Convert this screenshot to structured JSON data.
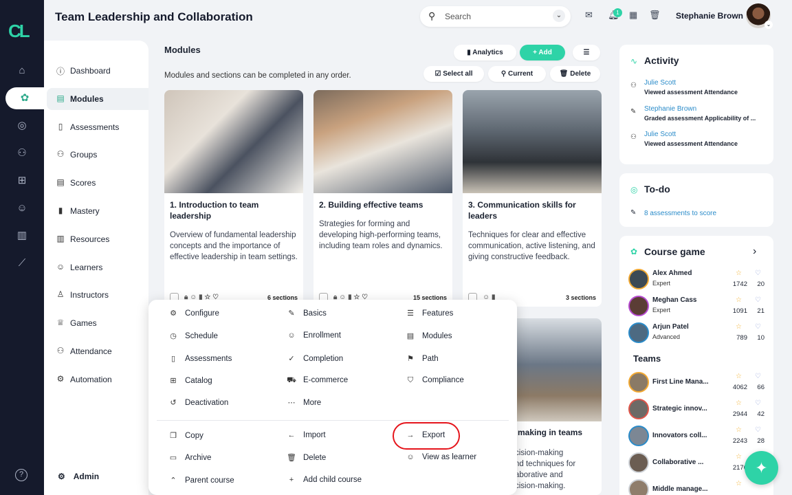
{
  "app": {
    "logo_text": "CL",
    "accent": "#2ed3a7",
    "sidebar_bg": "#151a2c",
    "highlight_color": "#e5141b"
  },
  "header": {
    "title": "Team Leadership and Collaboration",
    "search_placeholder": "Search",
    "notification_count": "1",
    "user_name": "Stephanie Brown"
  },
  "nav": [
    {
      "label": "Dashboard",
      "icon": "info-icon"
    },
    {
      "label": "Modules",
      "icon": "modules-icon",
      "active": true
    },
    {
      "label": "Assessments",
      "icon": "assessment-icon"
    },
    {
      "label": "Groups",
      "icon": "groups-icon"
    },
    {
      "label": "Scores",
      "icon": "scores-icon"
    },
    {
      "label": "Mastery",
      "icon": "mastery-icon"
    },
    {
      "label": "Resources",
      "icon": "resources-icon"
    },
    {
      "label": "Learners",
      "icon": "learners-icon"
    },
    {
      "label": "Instructors",
      "icon": "instructors-icon"
    },
    {
      "label": "Games",
      "icon": "trophy-icon"
    },
    {
      "label": "Attendance",
      "icon": "attendance-icon"
    },
    {
      "label": "Automation",
      "icon": "automation-icon"
    }
  ],
  "admin_label": "Admin",
  "modules": {
    "title": "Modules",
    "subtitle": "Modules and sections can be completed in any order.",
    "toolbar": {
      "analytics": "Analytics",
      "add": "+ Add",
      "select_all": "Select all",
      "current": "Current",
      "delete": "Delete"
    },
    "cards": [
      {
        "title": "1. Introduction to team leadership",
        "desc": "Overview of fundamental leadership concepts and the importance of effective leadership in team settings.",
        "sections": "6 sections"
      },
      {
        "title": "2. Building effective teams",
        "desc": "Strategies for forming and developing high-performing teams, including team roles and dynamics.",
        "sections": "15 sections"
      },
      {
        "title": "3. Communication skills for leaders",
        "desc": "Techniques for clear and effective communication, active listening, and giving constructive feedback.",
        "sections": "3 sections"
      }
    ],
    "card4": {
      "title": "making in teams",
      "desc_lines": [
        "cision-making",
        "nd techniques for",
        "aborative and",
        "cision-making."
      ]
    }
  },
  "menu": {
    "col1": [
      "Configure",
      "Schedule",
      "Assessments",
      "Catalog",
      "Deactivation"
    ],
    "col2": [
      "Basics",
      "Enrollment",
      "Completion",
      "E-commerce",
      "More"
    ],
    "col3": [
      "Features",
      "Modules",
      "Path",
      "Compliance"
    ],
    "bottom1": [
      "Copy",
      "Archive",
      "Parent course"
    ],
    "bottom2": [
      "Import",
      "Delete",
      "Add child course"
    ],
    "bottom3": [
      "Export",
      "View as learner"
    ]
  },
  "activity": {
    "title": "Activity",
    "items": [
      {
        "name": "Julie Scott",
        "text": "Viewed assessment Attendance"
      },
      {
        "name": "Stephanie Brown",
        "text": "Graded assessment Applicability of ..."
      },
      {
        "name": "Julie Scott",
        "text": "Viewed assessment Attendance"
      }
    ]
  },
  "todo": {
    "title": "To-do",
    "link": "8 assessments to score"
  },
  "game": {
    "title": "Course game",
    "players": [
      {
        "name": "Alex Ahmed",
        "rank": "Expert",
        "points": "1742",
        "badges": "20"
      },
      {
        "name": "Meghan Cass",
        "rank": "Expert",
        "points": "1091",
        "badges": "21"
      },
      {
        "name": "Arjun Patel",
        "rank": "Advanced",
        "points": "789",
        "badges": "10"
      }
    ],
    "teams_title": "Teams",
    "teams": [
      {
        "name": "First Line Mana...",
        "points": "4062",
        "badges": "66"
      },
      {
        "name": "Strategic innov...",
        "points": "2944",
        "badges": "42"
      },
      {
        "name": "Innovators coll...",
        "points": "2243",
        "badges": "28"
      },
      {
        "name": "Collaborative ...",
        "points": "2176",
        "badges": ""
      },
      {
        "name": "Middle manage...",
        "points": "",
        "badges": ""
      }
    ]
  }
}
